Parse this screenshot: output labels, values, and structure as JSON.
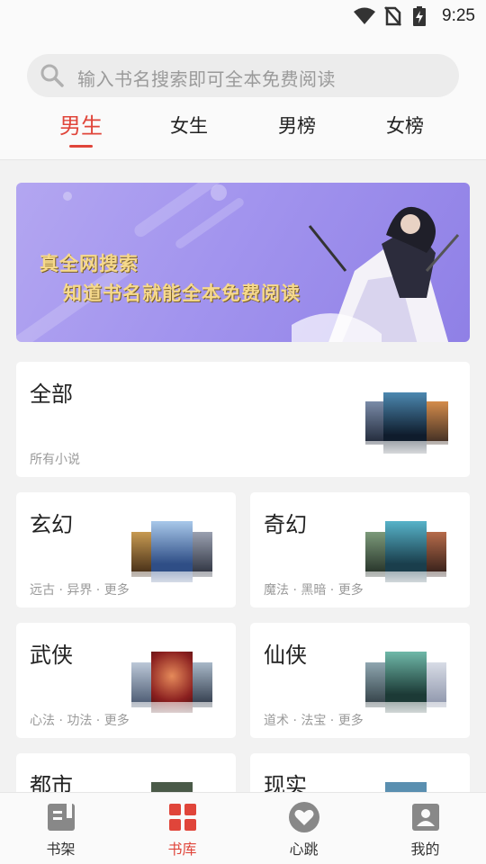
{
  "status_bar": {
    "time": "9:25",
    "icons": [
      "wifi-icon",
      "no-sim-icon",
      "battery-charging-icon"
    ]
  },
  "search": {
    "placeholder": "输入书名搜索即可全本免费阅读",
    "icon": "search-icon"
  },
  "tabs": [
    {
      "label": "男生",
      "active": true
    },
    {
      "label": "女生",
      "active": false
    },
    {
      "label": "男榜",
      "active": false
    },
    {
      "label": "女榜",
      "active": false
    }
  ],
  "banner": {
    "line1": "真全网搜索",
    "line2": "知道书名就能全本免费阅读"
  },
  "categories": [
    {
      "title": "全部",
      "sub": "所有小说"
    },
    {
      "title": "玄幻",
      "sub": "远古 · 异界 · 更多"
    },
    {
      "title": "奇幻",
      "sub": "魔法 · 黑暗 · 更多"
    },
    {
      "title": "武侠",
      "sub": "心法 · 功法 · 更多"
    },
    {
      "title": "仙侠",
      "sub": "道术 · 法宝 · 更多"
    },
    {
      "title": "都市",
      "sub": ""
    },
    {
      "title": "现实",
      "sub": ""
    }
  ],
  "bottom_nav": [
    {
      "label": "书架",
      "icon": "bookshelf-icon",
      "active": false
    },
    {
      "label": "书库",
      "icon": "library-grid-icon",
      "active": true
    },
    {
      "label": "心跳",
      "icon": "heart-icon",
      "active": false
    },
    {
      "label": "我的",
      "icon": "profile-icon",
      "active": false
    }
  ],
  "colors": {
    "accent": "#e0453a",
    "banner": "#a294ee",
    "gold_text": "#f6d98b"
  }
}
